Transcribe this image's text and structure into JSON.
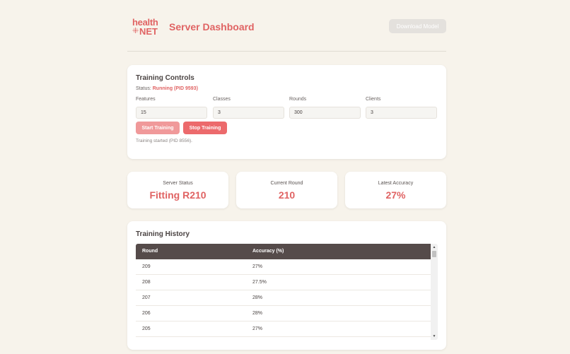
{
  "header": {
    "logo_top": "health",
    "logo_star": "⁜",
    "logo_bottom": "NET",
    "title": "Server Dashboard",
    "download_label": "Download Model"
  },
  "controls": {
    "title": "Training Controls",
    "status_prefix": "Status: ",
    "status_value": "Running (PID 9593)",
    "fields": [
      {
        "label": "Features",
        "value": "15"
      },
      {
        "label": "Classes",
        "value": "3"
      },
      {
        "label": "Rounds",
        "value": "300"
      },
      {
        "label": "Clients",
        "value": "3"
      }
    ],
    "start_label": "Start Training",
    "stop_label": "Stop Training",
    "log": "Training started (PID 8556)."
  },
  "stats": [
    {
      "label": "Server Status",
      "value": "Fitting R210"
    },
    {
      "label": "Current Round",
      "value": "210"
    },
    {
      "label": "Latest Accuracy",
      "value": "27%"
    }
  ],
  "history": {
    "title": "Training History",
    "columns": [
      "Round",
      "Accuracy (%)"
    ],
    "rows": [
      [
        "209",
        "27%"
      ],
      [
        "208",
        "27.5%"
      ],
      [
        "207",
        "28%"
      ],
      [
        "206",
        "28%"
      ],
      [
        "205",
        "27%"
      ]
    ]
  },
  "colors": {
    "accent": "#e06363",
    "background": "#f7f3eb",
    "table_header": "#554b4a"
  }
}
